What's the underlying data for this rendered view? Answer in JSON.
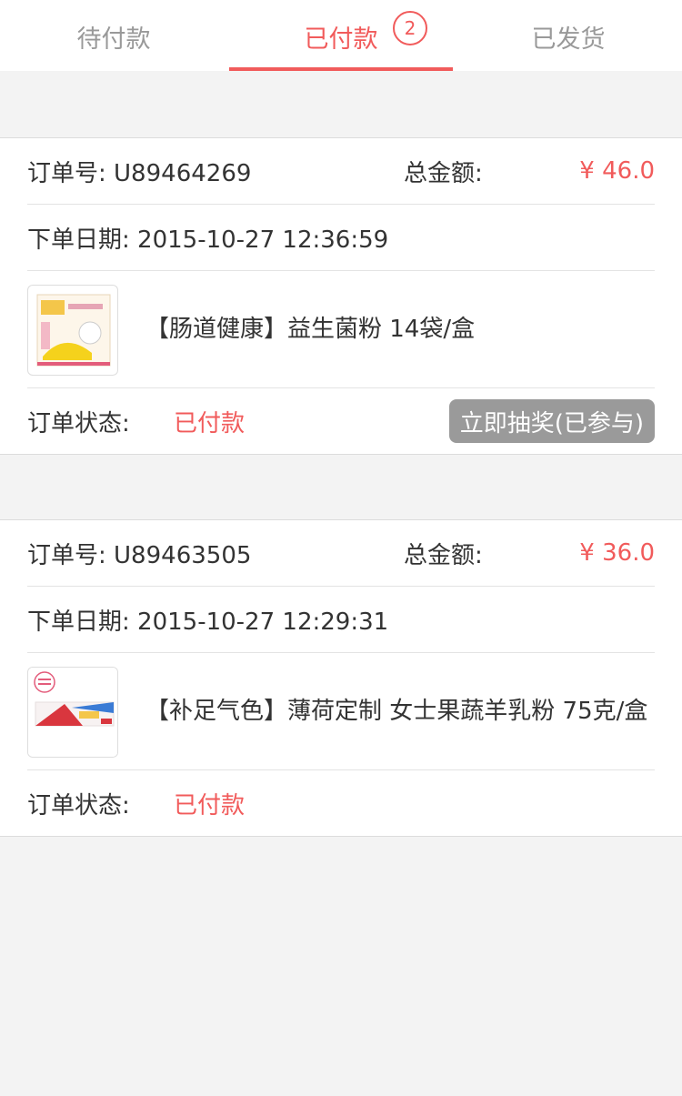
{
  "tabs": [
    {
      "label": "待付款",
      "active": false
    },
    {
      "label": "已付款",
      "active": true,
      "badge": "2"
    },
    {
      "label": "已发货",
      "active": false
    }
  ],
  "labels": {
    "order_no_prefix": "订单号: ",
    "total": "总金额:",
    "date_prefix": "下单日期: ",
    "status": "订单状态:"
  },
  "orders": [
    {
      "order_no": "U89464269",
      "total": "¥ 46.0",
      "date": "2015-10-27 12:36:59",
      "product_name": "【肠道健康】益生菌粉 14袋/盒",
      "status": "已付款",
      "action": "立即抽奖(已参与)"
    },
    {
      "order_no": "U89463505",
      "total": "¥ 36.0",
      "date": "2015-10-27 12:29:31",
      "product_name": "【补足气色】薄荷定制 女士果蔬羊乳粉 75克/盒",
      "status": "已付款"
    }
  ],
  "colors": {
    "accent": "#f15b5b",
    "button_gray": "#9a9a9a",
    "background": "#f3f3f3"
  }
}
